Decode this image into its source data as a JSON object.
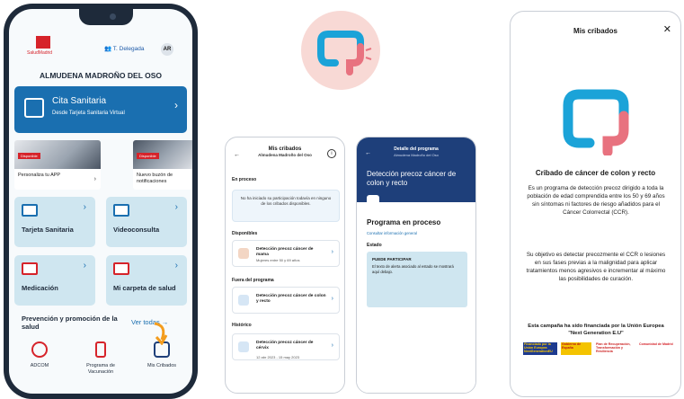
{
  "phone1": {
    "brand_text": "SaludMadrid",
    "delegate": "T. Delegada",
    "avatar": "AR",
    "patient_name": "ALMUDENA MADROÑO DEL OSO",
    "cita": {
      "title": "Cita Sanitaria",
      "subtitle": "Desde Tarjeta Sanitaria Virtual"
    },
    "promos": [
      {
        "tag": "Disponible",
        "label": "Personaliza tu APP"
      },
      {
        "tag": "Disponible",
        "label": "Nuevo buzón de notificaciones"
      }
    ],
    "tiles": [
      {
        "label": "Tarjeta Sanitaria",
        "icon": "id-card-icon"
      },
      {
        "label": "Videoconsulta",
        "icon": "video-icon"
      },
      {
        "label": "Medicación",
        "icon": "pills-icon"
      },
      {
        "label": "Mi carpeta de salud",
        "icon": "folder-heart-icon"
      }
    ],
    "prevention_title": "Prevención y promoción de la salud",
    "see_all": "Ver todas",
    "bottom": [
      {
        "label": "ADCOM",
        "icon": "document-icon"
      },
      {
        "label": "Programa de Vacunación",
        "icon": "vaccine-icon"
      },
      {
        "label": "Mis Cribados",
        "icon": "people-icon"
      }
    ]
  },
  "phone2": {
    "title": "Mis cribados",
    "subtitle": "Almudena Madroño del Oso",
    "sections": {
      "in_process": "En proceso",
      "in_process_msg": "No ha iniciado su participación todavía en ninguno de los cribados disponibles.",
      "available": "Disponibles",
      "outside": "Fuera del programa",
      "historic": "Histórico"
    },
    "items": [
      {
        "title": "Detección precoz cáncer de mama",
        "sub": "Mujeres entre 50 y 69 años"
      },
      {
        "title": "Detección precoz cáncer de colon y recto",
        "sub": ""
      },
      {
        "title": "Detección precoz cáncer de cérvix",
        "sub": "12 abr 2023 - 15 may 2023"
      }
    ]
  },
  "phone3": {
    "header_title": "Detalle del programa",
    "header_sub": "Almudena Madroño del Oso",
    "program_title": "Detección precoz cáncer de colon y recto",
    "status_title": "Programa en proceso",
    "consult": "Consultar información general",
    "state_label": "Estado",
    "box_title": "PUEDE PARTICIPAR",
    "box_text": "El texto de alerta asociado al estado se mostrará aquí debajo."
  },
  "phone4": {
    "title": "Mis cribados",
    "heading": "Cribado de cáncer de colon y recto",
    "para1": "Es un programa de detección precoz dirigido a toda la población de edad comprendida entre los 50 y 69 años sin síntomas ni factores de riesgo añadidos para el Cáncer Colorrectal (CCR).",
    "para2": "Su objetivo es detectar precozmente el CCR o lesiones en sus fases previas a la malignidad para aplicar tratamientos menos agresivos e incrementar al máximo las posibilidades de curación.",
    "footer": "Esta campaña ha sido financiada por la Unión Europea \"Next Generation E.U\"",
    "logos": [
      "Financiado por la Unión Europea NextGenerationEU",
      "Gobierno de España",
      "Plan de Recuperación, Transformación y Resiliencia",
      "Comunidad de Madrid"
    ]
  },
  "colors": {
    "primary": "#1a6fb0",
    "dark_navy": "#1e3f7a",
    "tile": "#cfe6f0",
    "accent_red": "#d6232a",
    "colon_blue": "#1ba3d8",
    "colon_pink": "#e8727f",
    "medallion": "#f8d9d5",
    "arrow_orange": "#f39c1d"
  }
}
